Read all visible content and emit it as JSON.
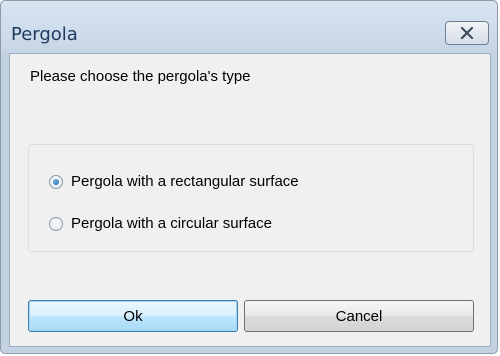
{
  "window": {
    "title": "Pergola",
    "close_icon": "close-x-icon"
  },
  "dialog": {
    "prompt": "Please choose the pergola's type",
    "options": [
      {
        "label": "Pergola with a rectangular surface",
        "selected": true
      },
      {
        "label": "Pergola with a circular surface",
        "selected": false
      }
    ],
    "ok_label": "Ok",
    "cancel_label": "Cancel"
  },
  "colors": {
    "accent": "#3c7fb1",
    "titlebar": "#c6d5e6",
    "client": "#f0f0f0"
  }
}
